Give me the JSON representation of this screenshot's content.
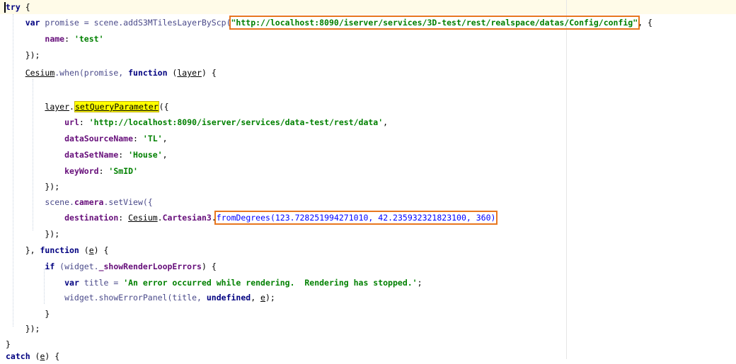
{
  "editor": {
    "lines": [
      {
        "tokens": [
          {
            "t": "try",
            "c": "kw"
          },
          {
            "t": " {",
            "c": "punc"
          }
        ]
      },
      {
        "tokens": [
          {
            "t": "    var",
            "c": "kw"
          },
          {
            "t": " promise = scene.addS3MTilesLayerByScp(",
            "c": "id"
          },
          {
            "t": "\"http://localhost:8090/iserver/services/3D-test/rest/realspace/datas/Config/config\"",
            "c": "str",
            "box": true
          },
          {
            "t": ", {",
            "c": "punc"
          }
        ]
      },
      {
        "tokens": [
          {
            "t": "        ",
            "c": "punc"
          },
          {
            "t": "name",
            "c": "prop"
          },
          {
            "t": ": ",
            "c": "punc"
          },
          {
            "t": "'test'",
            "c": "str"
          }
        ]
      },
      {
        "tokens": [
          {
            "t": "    });",
            "c": "punc"
          }
        ]
      },
      {
        "tokens": [
          {
            "t": "    ",
            "c": "punc"
          },
          {
            "t": "Cesium",
            "c": "cls"
          },
          {
            "t": ".when(promise, ",
            "c": "id"
          },
          {
            "t": "function",
            "c": "kw"
          },
          {
            "t": " (",
            "c": "punc"
          },
          {
            "t": "layer",
            "c": "param"
          },
          {
            "t": ") {",
            "c": "punc"
          }
        ]
      },
      {
        "tokens": [
          {
            "t": "",
            "c": "punc"
          }
        ]
      },
      {
        "tokens": [
          {
            "t": "        ",
            "c": "punc"
          },
          {
            "t": "layer",
            "c": "param"
          },
          {
            "t": ".",
            "c": "punc"
          },
          {
            "t": "setQueryParameter",
            "c": "hl"
          },
          {
            "t": "({",
            "c": "punc"
          }
        ]
      },
      {
        "tokens": [
          {
            "t": "            ",
            "c": "punc"
          },
          {
            "t": "url",
            "c": "prop"
          },
          {
            "t": ": ",
            "c": "punc"
          },
          {
            "t": "'http://localhost:8090/iserver/services/data-test/rest/data'",
            "c": "str"
          },
          {
            "t": ",",
            "c": "punc"
          }
        ]
      },
      {
        "tokens": [
          {
            "t": "            ",
            "c": "punc"
          },
          {
            "t": "dataSourceName",
            "c": "prop"
          },
          {
            "t": ": ",
            "c": "punc"
          },
          {
            "t": "'TL'",
            "c": "str"
          },
          {
            "t": ",",
            "c": "punc"
          }
        ]
      },
      {
        "tokens": [
          {
            "t": "            ",
            "c": "punc"
          },
          {
            "t": "dataSetName",
            "c": "prop"
          },
          {
            "t": ": ",
            "c": "punc"
          },
          {
            "t": "'House'",
            "c": "str"
          },
          {
            "t": ",",
            "c": "punc"
          }
        ]
      },
      {
        "tokens": [
          {
            "t": "            ",
            "c": "punc"
          },
          {
            "t": "keyWord",
            "c": "prop"
          },
          {
            "t": ": ",
            "c": "punc"
          },
          {
            "t": "'SmID'",
            "c": "str"
          }
        ]
      },
      {
        "tokens": [
          {
            "t": "        });",
            "c": "punc"
          }
        ]
      },
      {
        "tokens": [
          {
            "t": "        scene.",
            "c": "id"
          },
          {
            "t": "camera",
            "c": "prop"
          },
          {
            "t": ".setView({",
            "c": "id"
          }
        ]
      },
      {
        "tokens": [
          {
            "t": "            ",
            "c": "punc"
          },
          {
            "t": "destination",
            "c": "prop"
          },
          {
            "t": ": ",
            "c": "punc"
          },
          {
            "t": "Cesium",
            "c": "cls"
          },
          {
            "t": ".",
            "c": "punc"
          },
          {
            "t": "Cartesian3",
            "c": "prop"
          },
          {
            "t": ".",
            "c": "punc"
          },
          {
            "t": "fromDegrees(123.728251994271010, 42.235932321823100, 360)",
            "c": "num",
            "box": true
          }
        ]
      },
      {
        "tokens": [
          {
            "t": "        });",
            "c": "punc"
          }
        ]
      },
      {
        "tokens": [
          {
            "t": "    }, ",
            "c": "punc"
          },
          {
            "t": "function",
            "c": "kw"
          },
          {
            "t": " (",
            "c": "punc"
          },
          {
            "t": "e",
            "c": "param"
          },
          {
            "t": ") {",
            "c": "punc"
          }
        ]
      },
      {
        "tokens": [
          {
            "t": "        ",
            "c": "punc"
          },
          {
            "t": "if",
            "c": "kw"
          },
          {
            "t": " (widget.",
            "c": "id"
          },
          {
            "t": "_showRenderLoopErrors",
            "c": "prop"
          },
          {
            "t": ") {",
            "c": "punc"
          }
        ]
      },
      {
        "tokens": [
          {
            "t": "            ",
            "c": "punc"
          },
          {
            "t": "var",
            "c": "kw"
          },
          {
            "t": " title = ",
            "c": "id"
          },
          {
            "t": "'An error occurred while rendering.  Rendering has stopped.'",
            "c": "str"
          },
          {
            "t": ";",
            "c": "punc"
          }
        ]
      },
      {
        "tokens": [
          {
            "t": "            widget.showErrorPanel(title, ",
            "c": "id"
          },
          {
            "t": "undefined",
            "c": "kw"
          },
          {
            "t": ", ",
            "c": "punc"
          },
          {
            "t": "e",
            "c": "param"
          },
          {
            "t": ");",
            "c": "punc"
          }
        ]
      },
      {
        "tokens": [
          {
            "t": "        }",
            "c": "punc"
          }
        ]
      },
      {
        "tokens": [
          {
            "t": "    });",
            "c": "punc"
          }
        ]
      },
      {
        "tokens": [
          {
            "t": "}",
            "c": "punc"
          }
        ]
      },
      {
        "tokens": [
          {
            "t": "catch",
            "c": "kw"
          },
          {
            "t": " (",
            "c": "punc"
          },
          {
            "t": "e",
            "c": "param"
          },
          {
            "t": ") {",
            "c": "punc"
          }
        ]
      }
    ]
  }
}
